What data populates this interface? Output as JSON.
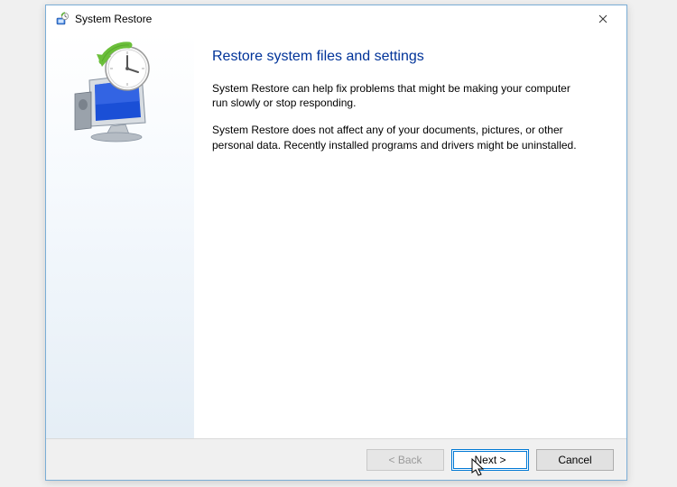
{
  "titlebar": {
    "title": "System Restore"
  },
  "main": {
    "heading": "Restore system files and settings",
    "para1": "System Restore can help fix problems that might be making your computer run slowly or stop responding.",
    "para2": "System Restore does not affect any of your documents, pictures, or other personal data. Recently installed programs and drivers might be uninstalled."
  },
  "footer": {
    "back": "< Back",
    "next": "Next >",
    "cancel": "Cancel"
  }
}
